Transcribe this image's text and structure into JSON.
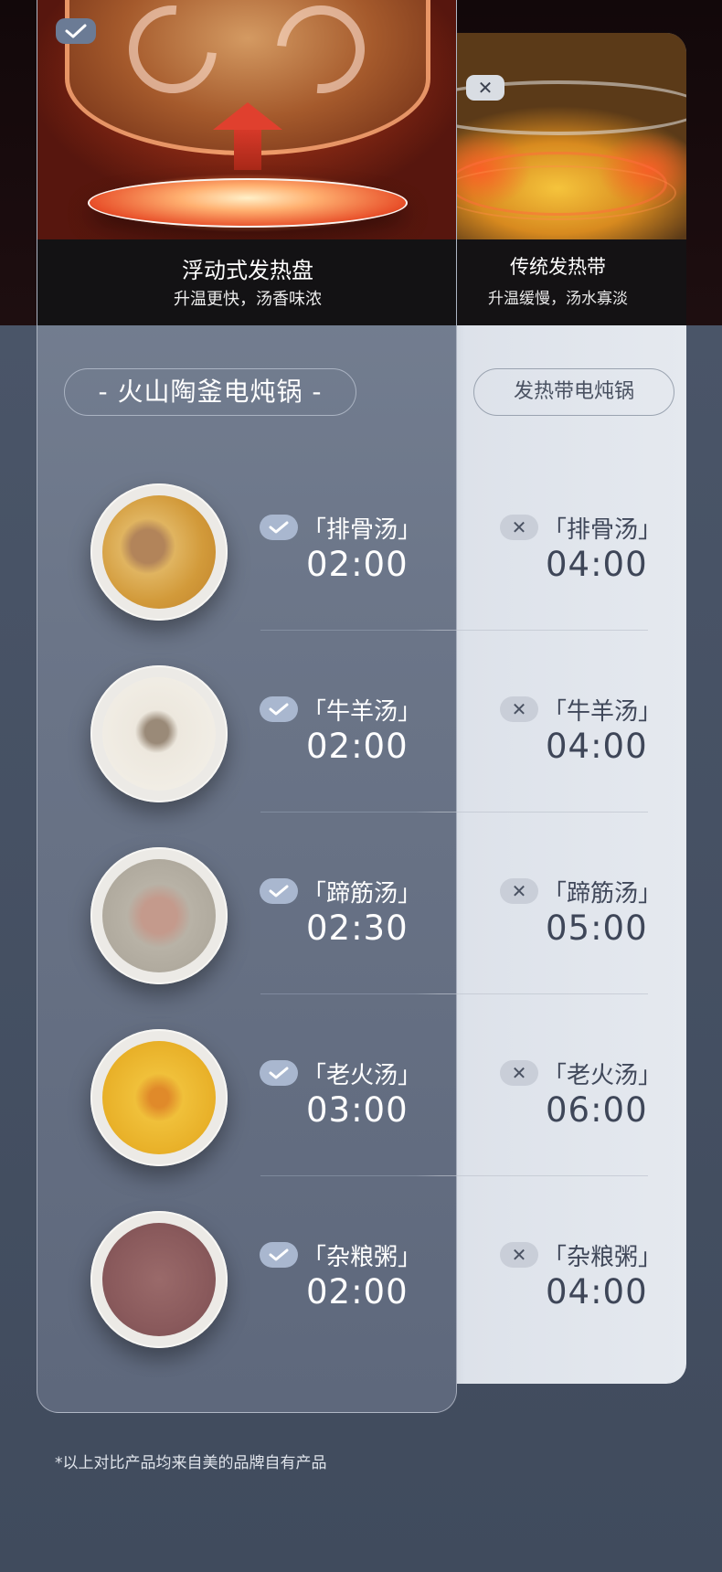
{
  "featured": {
    "heading": "浮动式发热盘",
    "subheading": "升温更快，汤香味浓",
    "product": "- 火山陶釜电炖锅 -"
  },
  "traditional": {
    "heading": "传统发热带",
    "subheading": "升温缓慢，汤水寡淡",
    "product": "发热带电炖锅"
  },
  "rows": [
    {
      "dish": "「排骨汤」",
      "featured_time": "02:00",
      "traditional_time": "04:00"
    },
    {
      "dish": "「牛羊汤」",
      "featured_time": "02:00",
      "traditional_time": "04:00"
    },
    {
      "dish": "「蹄筋汤」",
      "featured_time": "02:30",
      "traditional_time": "05:00"
    },
    {
      "dish": "「老火汤」",
      "featured_time": "03:00",
      "traditional_time": "06:00"
    },
    {
      "dish": "「杂粮粥」",
      "featured_time": "02:00",
      "traditional_time": "04:00"
    }
  ],
  "footnote": "*以上对比产品均来自美的品牌自有产品",
  "icons": {
    "yes": "check-icon",
    "no": "cross-icon",
    "cross_glyph": "✕"
  },
  "colors": {
    "page_bg": "#434e60",
    "featured_card": "#6b7588",
    "traditional_card": "#e5e9ef",
    "header_bar": "#131214"
  }
}
